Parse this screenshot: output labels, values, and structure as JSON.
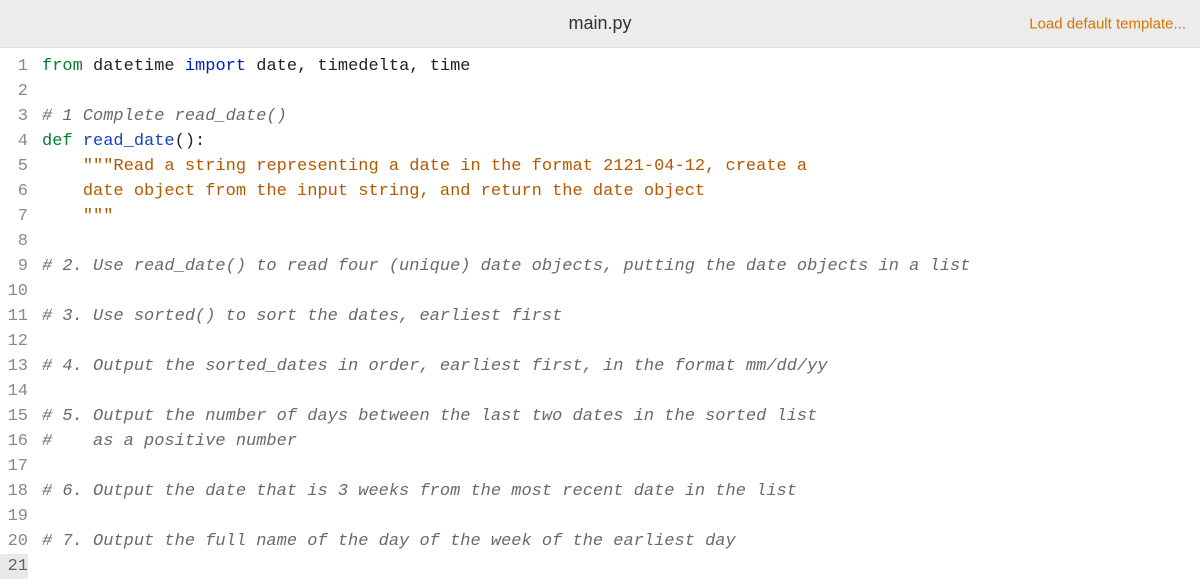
{
  "header": {
    "filename": "main.py",
    "load_default_label": "Load default template..."
  },
  "editor": {
    "current_line": 21,
    "lines": [
      {
        "n": 1,
        "tokens": [
          {
            "cls": "tok-kw-from",
            "t": "from"
          },
          {
            "cls": "",
            "t": " "
          },
          {
            "cls": "tok-ident",
            "t": "datetime"
          },
          {
            "cls": "",
            "t": " "
          },
          {
            "cls": "tok-kw-import",
            "t": "import"
          },
          {
            "cls": "",
            "t": " "
          },
          {
            "cls": "tok-ident",
            "t": "date, timedelta, time"
          }
        ]
      },
      {
        "n": 2,
        "tokens": []
      },
      {
        "n": 3,
        "tokens": [
          {
            "cls": "tok-comment",
            "t": "# 1 Complete read_date()"
          }
        ]
      },
      {
        "n": 4,
        "tokens": [
          {
            "cls": "tok-kw-def",
            "t": "def"
          },
          {
            "cls": "",
            "t": " "
          },
          {
            "cls": "tok-funcname",
            "t": "read_date"
          },
          {
            "cls": "tok-paren",
            "t": "():"
          }
        ]
      },
      {
        "n": 5,
        "tokens": [
          {
            "cls": "",
            "t": "    "
          },
          {
            "cls": "tok-docstring",
            "t": "\"\"\"Read a string representing a date in the format 2121-04-12, create a"
          }
        ]
      },
      {
        "n": 6,
        "tokens": [
          {
            "cls": "",
            "t": "    "
          },
          {
            "cls": "tok-docstring",
            "t": "date object from the input string, and return the date object"
          }
        ]
      },
      {
        "n": 7,
        "tokens": [
          {
            "cls": "",
            "t": "    "
          },
          {
            "cls": "tok-docstring",
            "t": "\"\"\""
          }
        ]
      },
      {
        "n": 8,
        "tokens": []
      },
      {
        "n": 9,
        "tokens": [
          {
            "cls": "tok-comment",
            "t": "# 2. Use read_date() to read four (unique) date objects, putting the date objects in a list"
          }
        ]
      },
      {
        "n": 10,
        "tokens": []
      },
      {
        "n": 11,
        "tokens": [
          {
            "cls": "tok-comment",
            "t": "# 3. Use sorted() to sort the dates, earliest first"
          }
        ]
      },
      {
        "n": 12,
        "tokens": []
      },
      {
        "n": 13,
        "tokens": [
          {
            "cls": "tok-comment",
            "t": "# 4. Output the sorted_dates in order, earliest first, in the format mm/dd/yy"
          }
        ]
      },
      {
        "n": 14,
        "tokens": []
      },
      {
        "n": 15,
        "tokens": [
          {
            "cls": "tok-comment",
            "t": "# 5. Output the number of days between the last two dates in the sorted list"
          }
        ]
      },
      {
        "n": 16,
        "tokens": [
          {
            "cls": "tok-comment",
            "t": "#    as a positive number"
          }
        ]
      },
      {
        "n": 17,
        "tokens": []
      },
      {
        "n": 18,
        "tokens": [
          {
            "cls": "tok-comment",
            "t": "# 6. Output the date that is 3 weeks from the most recent date in the list"
          }
        ]
      },
      {
        "n": 19,
        "tokens": []
      },
      {
        "n": 20,
        "tokens": [
          {
            "cls": "tok-comment",
            "t": "# 7. Output the full name of the day of the week of the earliest day"
          }
        ]
      },
      {
        "n": 21,
        "tokens": []
      }
    ]
  }
}
